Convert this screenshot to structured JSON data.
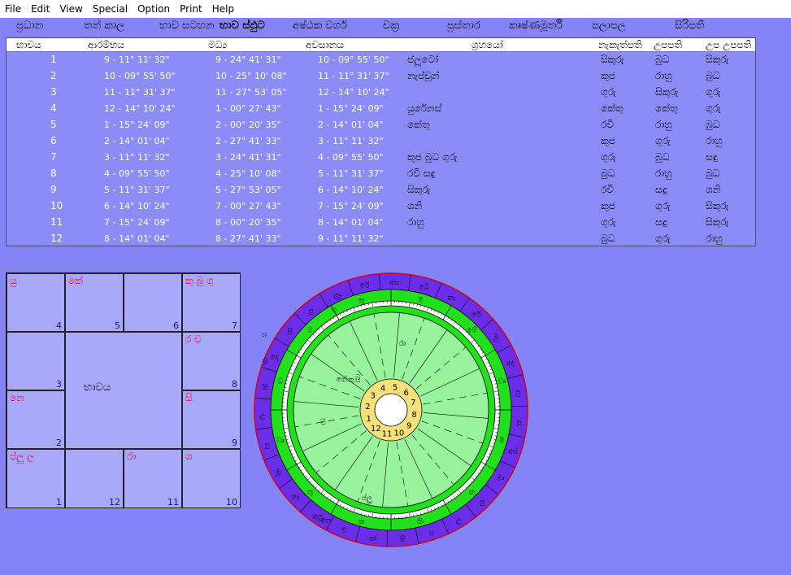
{
  "menu": [
    "File",
    "Edit",
    "View",
    "Special",
    "Option",
    "Print",
    "Help"
  ],
  "tabs": [
    {
      "label": "ප්‍රධාන",
      "active": false
    },
    {
      "label": "තත් කාල",
      "active": false
    },
    {
      "label": "භාව සටහන",
      "active": false
    },
    {
      "label": "භාව ස්ඵුට",
      "active": true
    },
    {
      "label": "අෂ්ඨක වර්ග",
      "active": false
    },
    {
      "label": "චක්‍ර",
      "active": false
    },
    {
      "label": "ප්‍රස්තාර",
      "active": false
    },
    {
      "label": "කෘෂ්ණමූර්ති",
      "active": false
    },
    {
      "label": "පලාපල",
      "active": false
    },
    {
      "label": "සිරිපති",
      "active": false
    }
  ],
  "table": {
    "headers": [
      "භාවය",
      "ආරම්භය",
      "මධ්‍ය",
      "අවසානය",
      "ග්‍රහයෝ",
      "නැකැත්පති",
      "උපපති",
      "උප උපපති"
    ],
    "rows": [
      {
        "house": "1",
        "start": "9 - 11° 11' 32\"",
        "mid": "9 - 24° 41' 31\"",
        "end": "10 - 09° 55' 50\"",
        "planets": "ප්ලූටෝ",
        "star": "සිකුරු",
        "sub": "බුධ",
        "subsub": "සිකුරු"
      },
      {
        "house": "2",
        "start": "10 - 09° 55' 50\"",
        "mid": "10 - 25° 10' 08\"",
        "end": "11 - 11° 31' 37\"",
        "planets": "නැප්චූන්",
        "star": "කුජ",
        "sub": "රාහු",
        "subsub": "බුධ"
      },
      {
        "house": "3",
        "start": "11 - 11° 31' 37\"",
        "mid": "11 - 27° 53' 05\"",
        "end": "12 - 14° 10' 24\"",
        "planets": "",
        "star": "ගුරු",
        "sub": "සිකුරු",
        "subsub": "ගුරු"
      },
      {
        "house": "4",
        "start": "12 - 14° 10' 24\"",
        "mid": "1 - 00° 27' 43\"",
        "end": "1 - 15° 24' 09\"",
        "planets": "යුරේනස්",
        "star": "කේතු",
        "sub": "කේතු",
        "subsub": "ගුරු"
      },
      {
        "house": "5",
        "start": "1 - 15° 24' 09\"",
        "mid": "2 - 00° 20' 35\"",
        "end": "2 - 14° 01' 04\"",
        "planets": "කේතු",
        "star": "රවි",
        "sub": "රාහු",
        "subsub": "බුධ"
      },
      {
        "house": "6",
        "start": "2 - 14° 01' 04\"",
        "mid": "2 - 27° 41' 33\"",
        "end": "3 - 11° 11' 32\"",
        "planets": "",
        "star": "කුජ",
        "sub": "ගුරු",
        "subsub": "රාහු"
      },
      {
        "house": "7",
        "start": "3 - 11° 11' 32\"",
        "mid": "3 - 24° 41' 31\"",
        "end": "4 - 09° 55' 50\"",
        "planets": "කුජ බුධ ගුරු",
        "star": "ගුරු",
        "sub": "බුධ",
        "subsub": "සඳු"
      },
      {
        "house": "8",
        "start": "4 - 09° 55' 50\"",
        "mid": "4 - 25° 10' 08\"",
        "end": "5 - 11° 31' 37\"",
        "planets": "රවි සඳු",
        "star": "බුධ",
        "sub": "රාහු",
        "subsub": "බුධ"
      },
      {
        "house": "9",
        "start": "5 - 11° 31' 37\"",
        "mid": "5 - 27° 53' 05\"",
        "end": "6 - 14° 10' 24\"",
        "planets": "සිකුරු",
        "star": "රවි",
        "sub": "සඳු",
        "subsub": "ශනි"
      },
      {
        "house": "10",
        "start": "6 - 14° 10' 24\"",
        "mid": "7 - 00° 27' 43\"",
        "end": "7 - 15° 24' 09\"",
        "planets": "ශනි",
        "star": "කුජ",
        "sub": "ගුරු",
        "subsub": "සිකුරු"
      },
      {
        "house": "11",
        "start": "7 - 15° 24' 09\"",
        "mid": "8 - 00° 20' 35\"",
        "end": "8 - 14° 01' 04\"",
        "planets": "රාහු",
        "star": "ගුරු",
        "sub": "සඳු",
        "subsub": "සිකුරු"
      },
      {
        "house": "12",
        "start": "8 - 14° 01' 04\"",
        "mid": "8 - 27° 41' 33\"",
        "end": "9 - 11° 11' 32\"",
        "planets": "",
        "star": "බුධ",
        "sub": "ගුරු",
        "subsub": "රාහු"
      }
    ]
  },
  "chart_grid": {
    "center_label": "භාවය",
    "cells": [
      {
        "house": "4",
        "planets": "යු"
      },
      {
        "house": "5",
        "planets": "කේ"
      },
      {
        "house": "6",
        "planets": ""
      },
      {
        "house": "7",
        "planets": "කු  බු  ගු"
      },
      {
        "house": "3",
        "planets": ""
      },
      {
        "house": "8",
        "planets": "ර  ච"
      },
      {
        "house": "2",
        "planets": "නෙ"
      },
      {
        "house": "9",
        "planets": "සි"
      },
      {
        "house": "1",
        "planets": "ප්ලු ල"
      },
      {
        "house": "12",
        "planets": ""
      },
      {
        "house": "11",
        "planets": "රා"
      },
      {
        "house": "10",
        "planets": "ශ"
      }
    ]
  },
  "wheel": {
    "house_numbers": [
      "1",
      "2",
      "3",
      "4",
      "5",
      "6",
      "7",
      "8",
      "9",
      "10",
      "11",
      "12"
    ],
    "signs": [
      "මේ",
      "වෘ",
      "මි",
      "ක",
      "සිං",
      "ක",
      "තු",
      "වෘ",
      "ධ",
      "ම",
      "කු",
      "මී"
    ],
    "nakshatras": [
      "අස",
      "බෙ",
      "කැ",
      "රේ",
      "මු",
      "අද",
      "පු",
      "පූ",
      "අස්",
      "මා",
      "පු",
      "උ",
      "හ",
      "සි",
      "සා",
      "වි",
      "අනු",
      "දෙ",
      "මූ",
      "පු",
      "උ",
      "සු",
      "දෙ",
      "සි",
      "පු",
      "උ",
      "රේ"
    ],
    "planets_in_wheel": [
      "යු",
      "කේ",
      "කු",
      "බු",
      "ගු",
      "ර",
      "ච",
      "සි",
      "ශ",
      "රා",
      "නෙ",
      "ප්ලු"
    ],
    "colors": {
      "outer": "#6a2ee8",
      "green_band": "#22e01c",
      "field": "#98f49c",
      "inner": "#f6e07a",
      "border": "#d4001e"
    }
  }
}
